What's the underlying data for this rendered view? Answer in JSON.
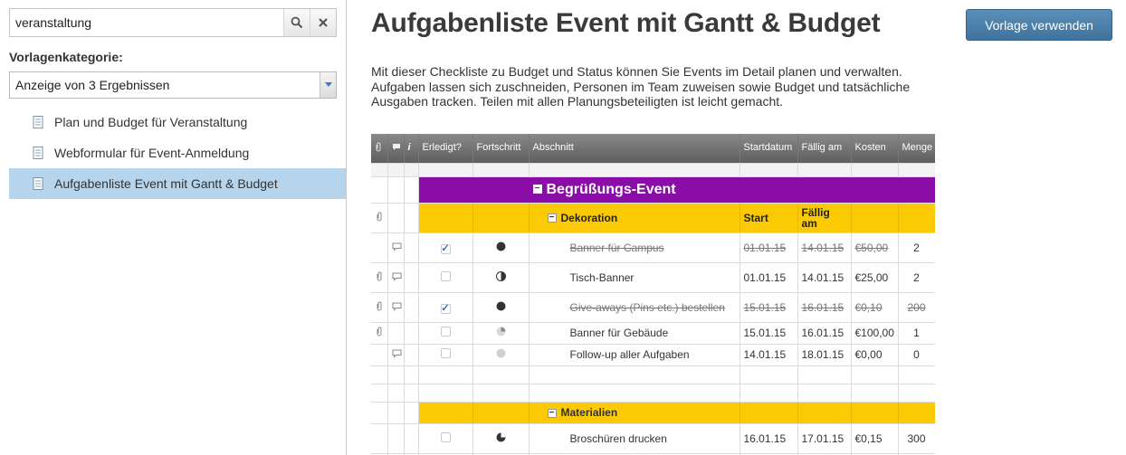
{
  "search": {
    "value": "veranstaltung"
  },
  "sidebar": {
    "category_label": "Vorlagenkategorie:",
    "select_value": "Anzeige von 3 Ergebnissen",
    "items": [
      {
        "label": "Plan und Budget für Veranstaltung"
      },
      {
        "label": "Webformular für Event-Anmeldung"
      },
      {
        "label": "Aufgabenliste Event mit Gantt & Budget"
      }
    ]
  },
  "main": {
    "title": "Aufgabenliste Event mit Gantt & Budget",
    "use_button": "Vorlage verwenden",
    "description": "Mit dieser Checkliste zu Budget und Status können Sie Events im Detail planen und verwalten. Aufgaben lassen sich zuschneiden, Personen im Team zuweisen sowie Budget und tatsächliche Ausgaben tracken. Teilen mit allen Planungsbeteiligten ist leicht gemacht."
  },
  "preview": {
    "headers": {
      "i": "i",
      "erledigt": "Erledigt?",
      "fortschritt": "Fortschritt",
      "abschnitt": "Abschnitt",
      "startdatum": "Startdatum",
      "faellig": "Fällig am",
      "kosten": "Kosten",
      "menge": "Menge"
    },
    "section_title": "Begrüßungs-Event",
    "group1": {
      "label": "Dekoration",
      "start": "Start",
      "faellig": "Fällig am"
    },
    "tasks1": [
      {
        "name": "Banner für Campus",
        "start": "01.01.15",
        "due": "14.01.15",
        "cost": "€50,00",
        "qty": "2"
      },
      {
        "name": "Tisch-Banner",
        "start": "01.01.15",
        "due": "14.01.15",
        "cost": "€25,00",
        "qty": "2"
      },
      {
        "name": "Give-aways (Pins etc.) bestellen",
        "start": "15.01.15",
        "due": "16.01.15",
        "cost": "€0,10",
        "qty": "200"
      },
      {
        "name": "Banner für Gebäude",
        "start": "15.01.15",
        "due": "16.01.15",
        "cost": "€100,00",
        "qty": "1"
      },
      {
        "name": "Follow-up aller Aufgaben",
        "start": "14.01.15",
        "due": "18.01.15",
        "cost": "€0,00",
        "qty": "0"
      }
    ],
    "group2": {
      "label": "Materialien"
    },
    "tasks2": [
      {
        "name": "Broschüren drucken",
        "start": "16.01.15",
        "due": "17.01.15",
        "cost": "€0,15",
        "qty": "300"
      }
    ],
    "check_mark": "✓",
    "minus_sign": "−"
  },
  "colors": {
    "accent_button": "#4a7fa8",
    "selection": "#b6d5ec",
    "section_purple": "#8a0da8",
    "group_yellow": "#fcca05"
  }
}
